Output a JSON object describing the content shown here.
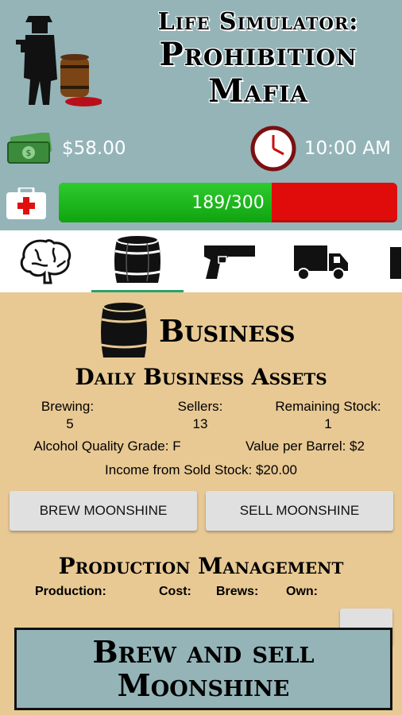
{
  "header": {
    "title_line1": "Life Simulator:",
    "title_line2": "Prohibition",
    "title_line3": "Mafia",
    "money": "$58.00",
    "time": "10:00 AM",
    "health": {
      "text": "189/300",
      "current": 189,
      "max": 300
    },
    "colors": {
      "header_bg": "#94b4b8",
      "health_green": "#1fb81f",
      "health_red": "#e00c0c"
    }
  },
  "tabs": [
    {
      "icon": "brain-icon",
      "active": false
    },
    {
      "icon": "barrel-icon",
      "active": true
    },
    {
      "icon": "pistol-icon",
      "active": false
    },
    {
      "icon": "truck-icon",
      "active": false
    }
  ],
  "business": {
    "title": "Business",
    "daily_title": "Daily Business Assets",
    "brewing_label": "Brewing:",
    "brewing_value": "5",
    "sellers_label": "Sellers:",
    "sellers_value": "13",
    "stock_label": "Remaining Stock:",
    "stock_value": "1",
    "quality": "Alcohol Quality Grade: F",
    "value_per_barrel": "Value per Barrel: $2",
    "income": "Income from Sold Stock:  $20.00",
    "brew_button": "BREW MOONSHINE",
    "sell_button": "SELL MOONSHINE"
  },
  "production": {
    "title": "Production Management",
    "headers": [
      "Production:",
      "Cost:",
      "Brews:",
      "Own:"
    ]
  },
  "banner": {
    "line1": "Brew and sell",
    "line2": "Moonshine"
  }
}
